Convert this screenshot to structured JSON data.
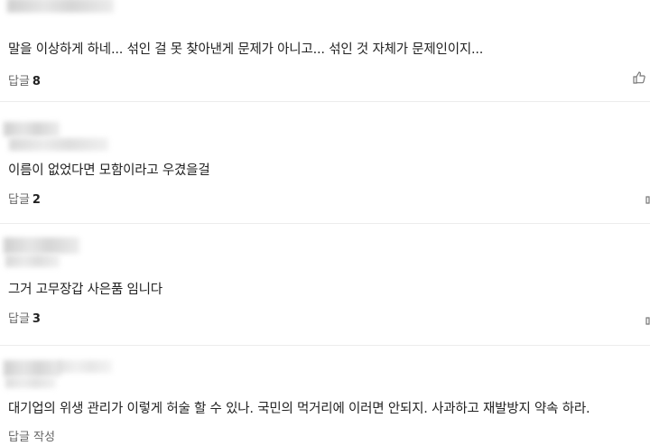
{
  "comments": [
    {
      "text": "말을 이상하게 하네... 섞인 걸 못 찾아낸게 문제가 아니고... 섞인 것 자체가 문제인이지...",
      "reply_label": "답글",
      "reply_count": "8"
    },
    {
      "text": "이름이 없었다면 모함이라고 우겼을걸",
      "reply_label": "답글",
      "reply_count": "2"
    },
    {
      "text": "그거 고무장갑 사은품 임니다",
      "reply_label": "답글",
      "reply_count": "3"
    },
    {
      "text": "대기업의 위생 관리가 이렇게 허술 할 수 있나. 국민의 먹거리에 이러면 안되지. 사과하고 재발방지 약속 하라.",
      "reply_label": "답글 작성"
    }
  ],
  "icons": {
    "like": "thumbs-up-icon"
  },
  "colors": {
    "divider": "#ececec",
    "muted": "#666666",
    "text": "#222222"
  }
}
